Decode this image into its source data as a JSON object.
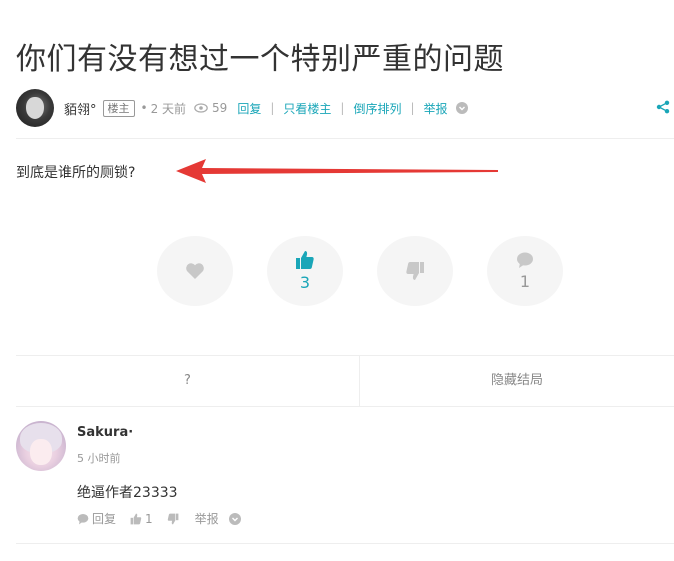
{
  "post": {
    "title": "你们有没有想过一个特别严重的问题",
    "author": "貊翎°",
    "badge": "楼主",
    "dot": "•",
    "time": "2 天前",
    "views": "59",
    "actions": [
      "回复",
      "只看楼主",
      "倒序排列",
      "举报"
    ],
    "separator": "|",
    "content": "到底是谁所的厕锁?"
  },
  "reactions": {
    "like_count": "3",
    "comment_count": "1"
  },
  "tabs": {
    "left": "?",
    "right": "隐藏结局"
  },
  "comment": {
    "author": "Sakura·",
    "time": "5 小时前",
    "text": "绝逼作者23333",
    "reply_label": "回复",
    "like_count": "1",
    "report_label": "举报"
  },
  "colors": {
    "accent": "#1aa6b8",
    "arrow": "#e53935",
    "muted": "#999999"
  }
}
